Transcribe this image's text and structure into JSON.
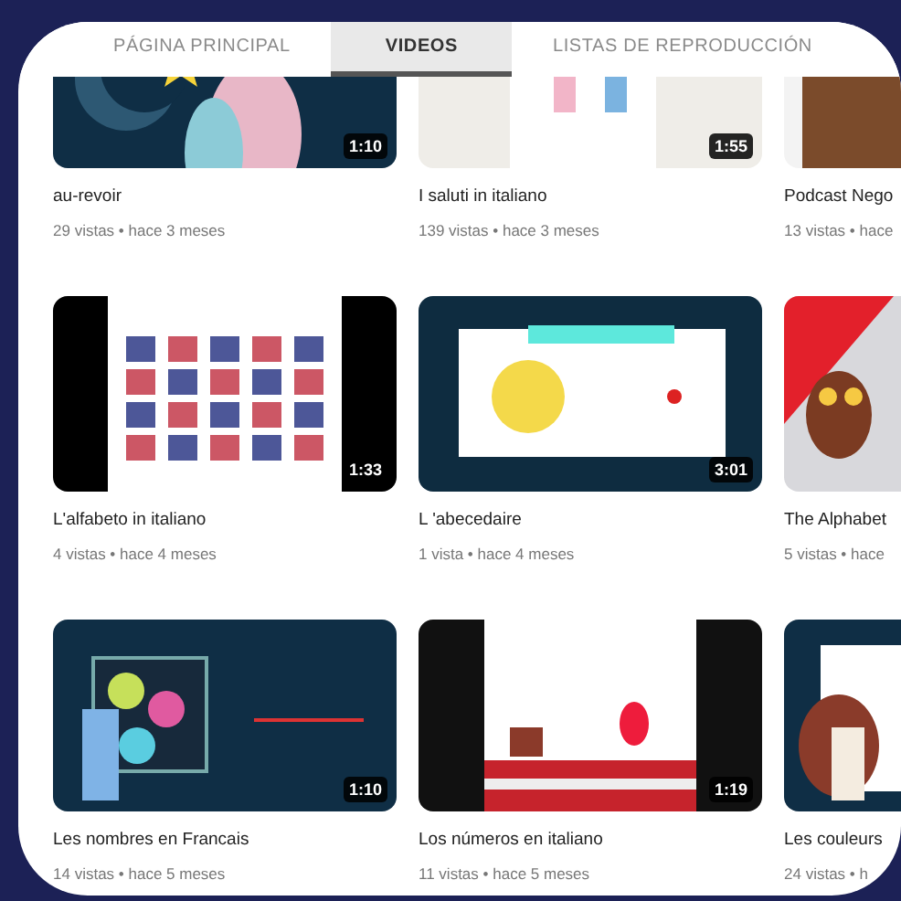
{
  "tabs": [
    {
      "label": "PÁGINA PRINCIPAL",
      "selected": false
    },
    {
      "label": "VIDEOS",
      "selected": true
    },
    {
      "label": "LISTAS DE REPRODUCCIÓN",
      "selected": false
    }
  ],
  "videos": [
    {
      "title": "au-revoir",
      "meta": "29 vistas • hace 3 meses",
      "duration": "1:10"
    },
    {
      "title": "I saluti in italiano",
      "meta": "139 vistas • hace 3 meses",
      "duration": "1:55"
    },
    {
      "title": "Podcast Nego",
      "meta": "13 vistas • hace"
    },
    {
      "title": "L'alfabeto in italiano",
      "meta": "4 vistas • hace 4 meses",
      "duration": "1:33"
    },
    {
      "title": "L 'abecedaire",
      "meta": "1 vista • hace 4 meses",
      "duration": "3:01"
    },
    {
      "title": "The Alphabet",
      "meta": "5 vistas • hace"
    },
    {
      "title": "Les nombres en Francais",
      "meta": "14 vistas • hace 5 meses",
      "duration": "1:10"
    },
    {
      "title": "Los números en italiano",
      "meta": "11 vistas • hace 5 meses",
      "duration": "1:19"
    },
    {
      "title": "Les couleurs",
      "meta": "24 vistas • h"
    }
  ]
}
